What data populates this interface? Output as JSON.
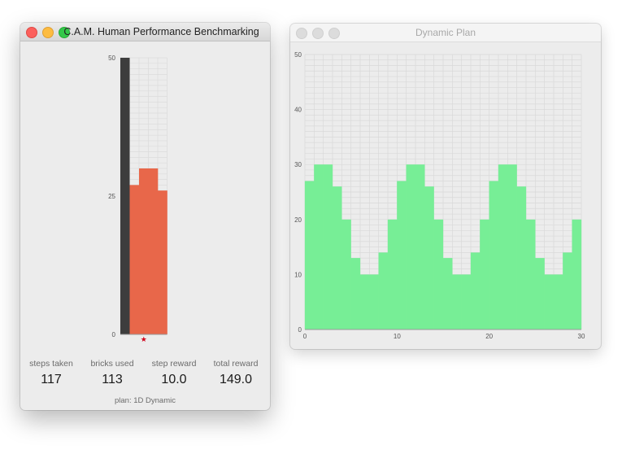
{
  "left_window": {
    "title": "C.A.M. Human Performance Benchmarking",
    "column_chart": {
      "y_ticks": [
        "50",
        "25",
        "0"
      ],
      "ylim": [
        0,
        50
      ],
      "agent_column_height": 50,
      "brick_columns": [
        27,
        30,
        30,
        26
      ],
      "marker_glyph": "★",
      "marker_color": "#d0021b"
    },
    "stats": [
      {
        "label": "steps taken",
        "value": "117"
      },
      {
        "label": "bricks used",
        "value": "113"
      },
      {
        "label": "step reward",
        "value": "10.0"
      },
      {
        "label": "total reward",
        "value": "149.0"
      }
    ],
    "plan_label": "plan: 1D Dynamic",
    "colors": {
      "bricks": "#e8674a",
      "agent": "#3d3d3d",
      "grid": "#dcdcdc"
    }
  },
  "right_window": {
    "title": "Dynamic Plan",
    "colors": {
      "fill": "#77ee96",
      "grid": "#d9d9d9"
    }
  },
  "chart_data": {
    "type": "area",
    "title": "Dynamic Plan",
    "xlabel": "",
    "ylabel": "",
    "xlim": [
      0,
      30
    ],
    "ylim": [
      0,
      50
    ],
    "x_ticks": [
      "0",
      "10",
      "20",
      "30"
    ],
    "y_ticks": [
      "0",
      "10",
      "20",
      "30",
      "40",
      "50"
    ],
    "grid": true,
    "step": true,
    "values": [
      27,
      30,
      30,
      26,
      20,
      13,
      10,
      10,
      14,
      20,
      27,
      30,
      30,
      26,
      20,
      13,
      10,
      10,
      14,
      20,
      27,
      30,
      30,
      26,
      20,
      13,
      10,
      10,
      14,
      20
    ]
  }
}
